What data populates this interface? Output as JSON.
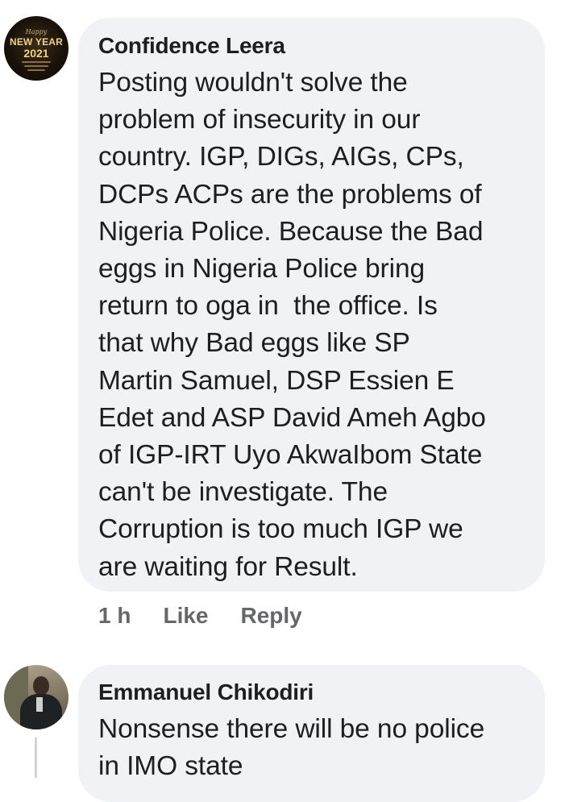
{
  "comments": [
    {
      "author": "Confidence Leera",
      "avatar": {
        "icon": "new-year-2021-avatar",
        "line1": "Happy",
        "line2": "NEW YEAR",
        "line3": "2021"
      },
      "text": "Posting wouldn't solve the\nproblem of insecurity in our\ncountry. IGP, DIGs, AIGs, CPs,\nDCPs ACPs are the problems of\nNigeria Police. Because the Bad\neggs in Nigeria Police bring\nreturn to oga in  the office. Is\nthat why Bad eggs like SP\nMartin Samuel, DSP Essien E\nEdet and ASP David Ameh Agbo\nof IGP-IRT Uyo AkwaIbom State\ncan't be investigate. The\nCorruption is too much IGP we\nare waiting for Result.",
      "time": "1 h",
      "like_label": "Like",
      "reply_label": "Reply"
    },
    {
      "author": "Emmanuel Chikodiri",
      "avatar": {
        "icon": "user-photo-avatar"
      },
      "text": "Nonsense there will be no police\nin IMO state"
    }
  ],
  "colors": {
    "bubble": "#f0f2f5",
    "text": "#1c1e21",
    "meta": "#65676b",
    "thread_line": "#d0d3d8"
  }
}
